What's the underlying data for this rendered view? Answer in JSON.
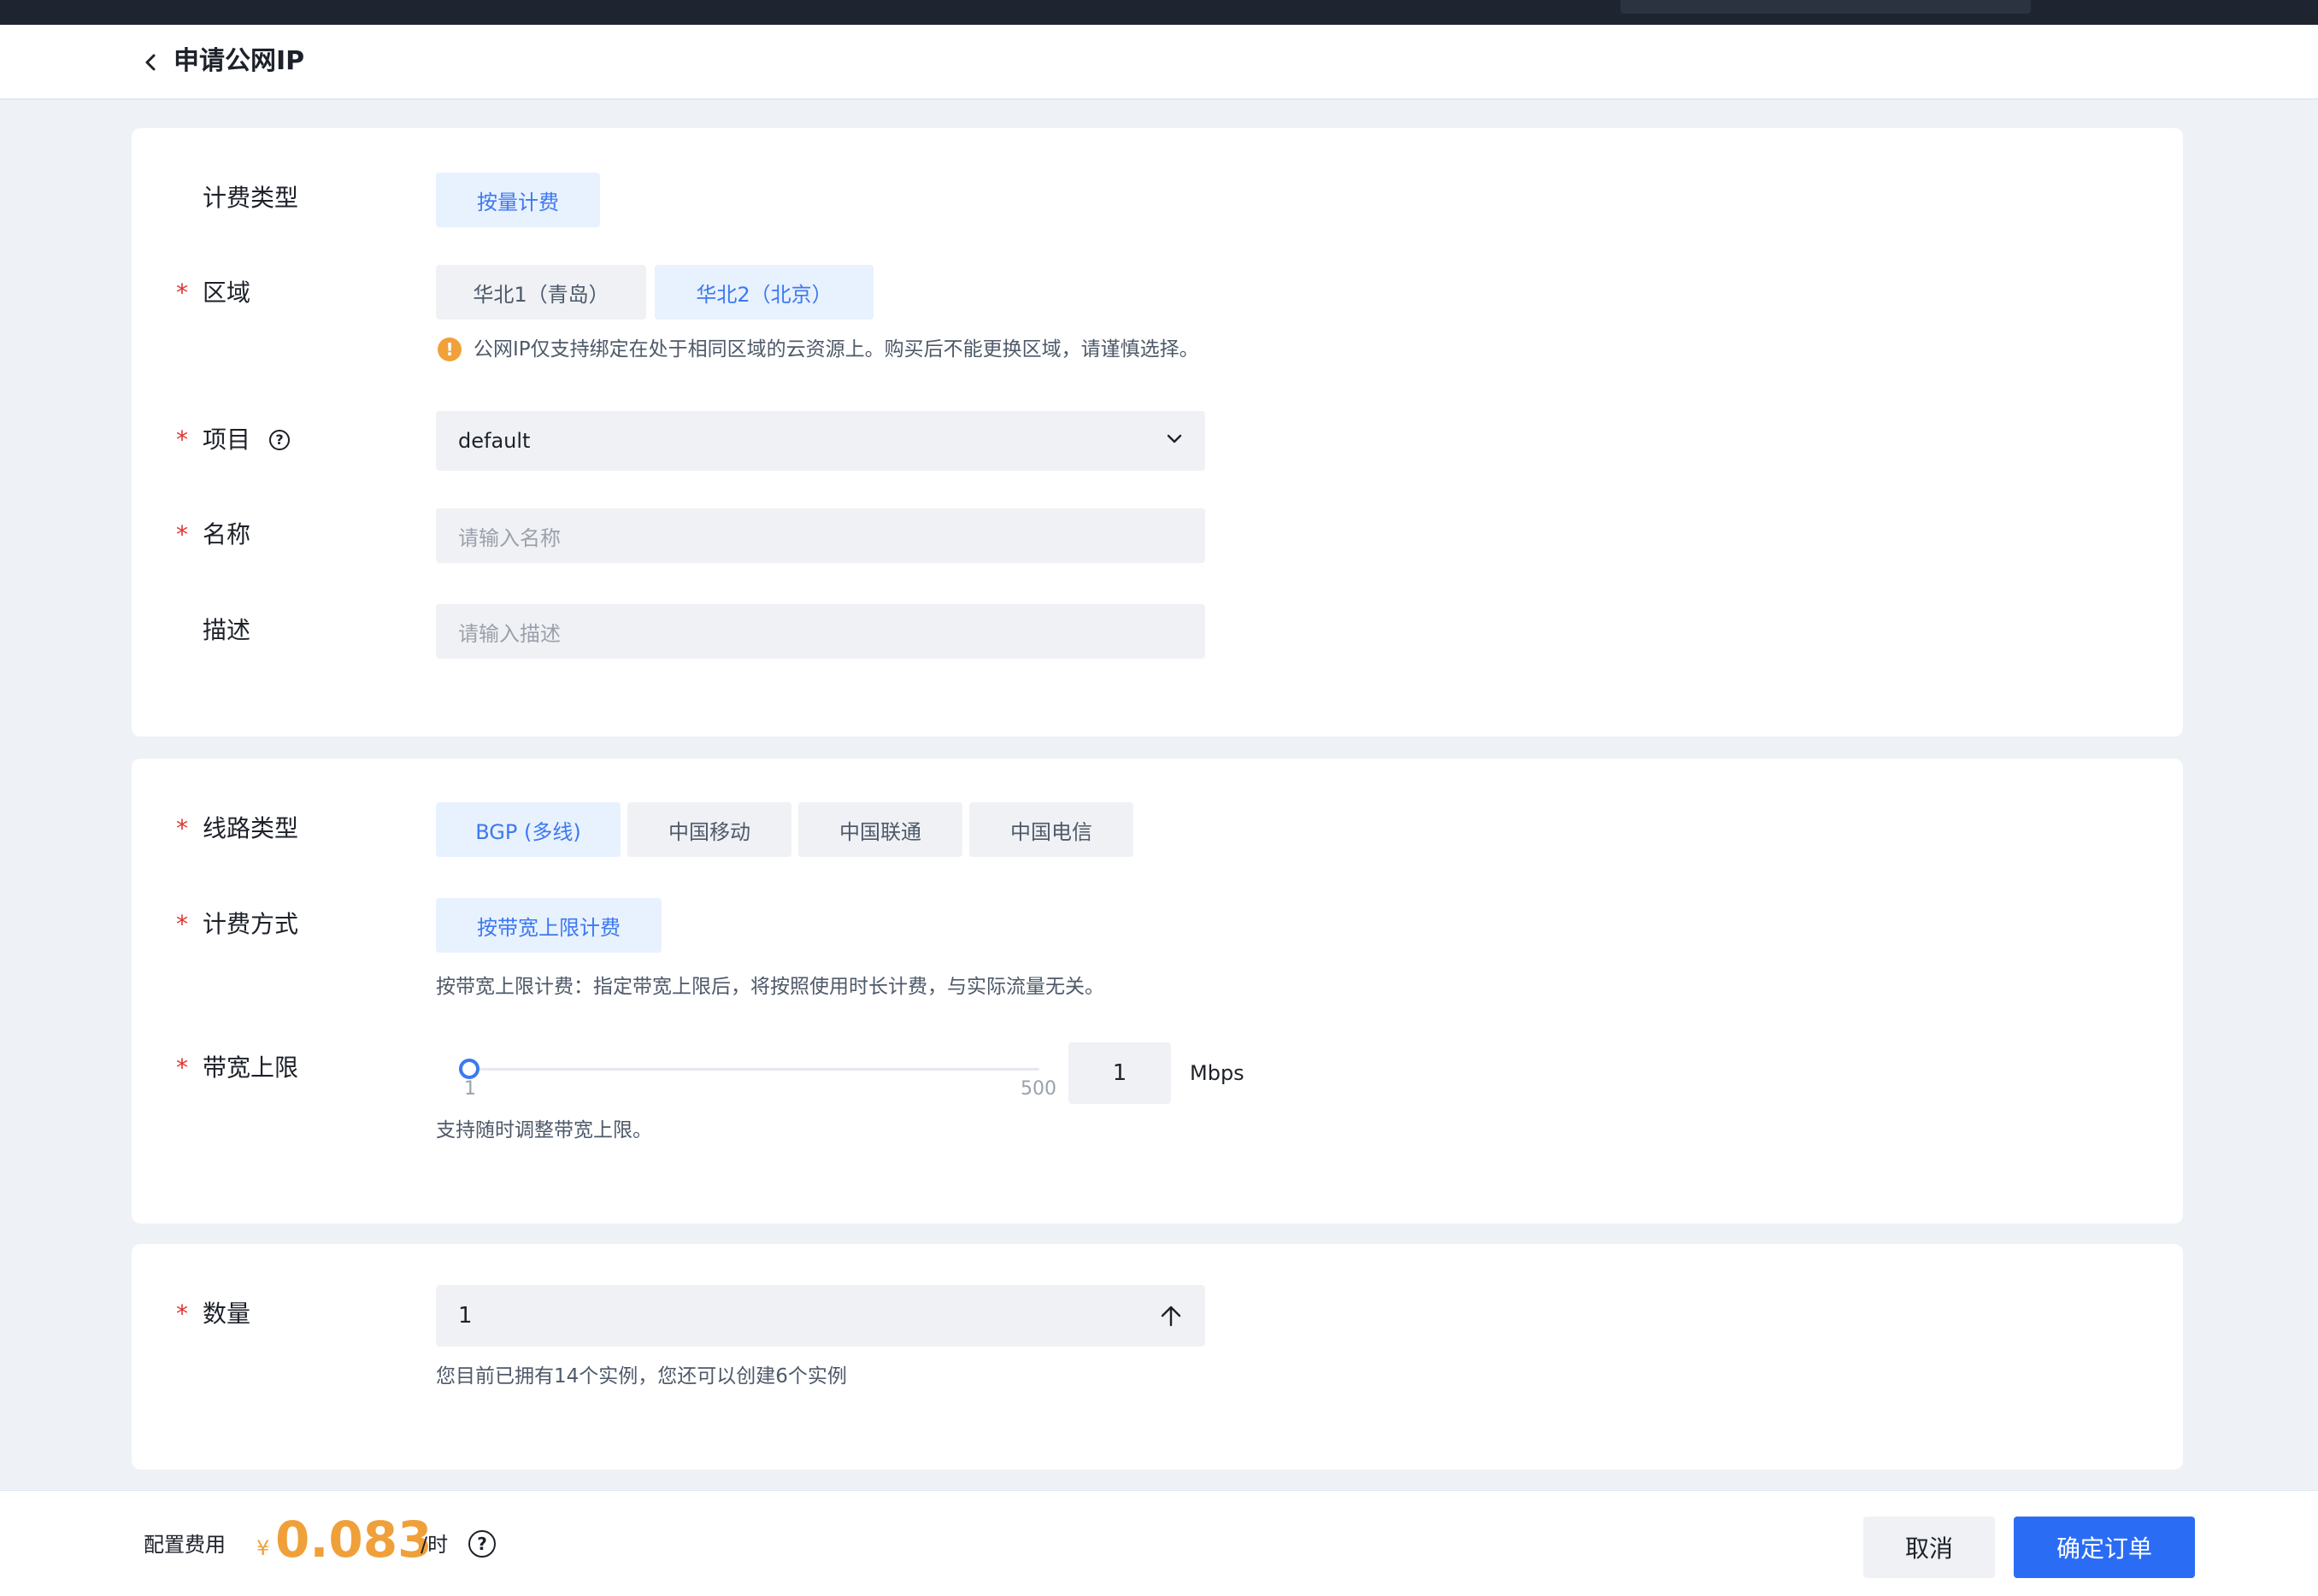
{
  "header": {
    "title": "申请公网IP"
  },
  "billing_type": {
    "label": "计费类型",
    "option": "按量计费"
  },
  "region": {
    "label": "区域",
    "options": [
      "华北1（青岛）",
      "华北2（北京）"
    ],
    "selected": "华北2（北京）",
    "warning": "公网IP仅支持绑定在处于相同区域的云资源上。购买后不能更换区域，请谨慎选择。"
  },
  "project": {
    "label": "项目",
    "value": "default"
  },
  "name": {
    "label": "名称",
    "placeholder": "请输入名称"
  },
  "description": {
    "label": "描述",
    "placeholder": "请输入描述"
  },
  "line_type": {
    "label": "线路类型",
    "options": [
      "BGP (多线)",
      "中国移动",
      "中国联通",
      "中国电信"
    ],
    "selected": "BGP (多线)"
  },
  "billing_method": {
    "label": "计费方式",
    "option": "按带宽上限计费",
    "hint": "按带宽上限计费：指定带宽上限后，将按照使用时长计费，与实际流量无关。"
  },
  "bandwidth": {
    "label": "带宽上限",
    "min": "1",
    "max": "500",
    "value": "1",
    "unit": "Mbps",
    "hint": "支持随时调整带宽上限。"
  },
  "quantity": {
    "label": "数量",
    "value": "1",
    "hint": "您目前已拥有14个实例，您还可以创建6个实例"
  },
  "footer": {
    "fee_label": "配置费用",
    "currency": "¥",
    "price": "0.083",
    "per_unit": "/时",
    "cancel_label": "取消",
    "confirm_label": "确定订单"
  },
  "colors": {
    "accent": "#3c79f0",
    "primary_button": "#2b6cf5",
    "price": "#f0a03a",
    "required": "#e0332f"
  }
}
